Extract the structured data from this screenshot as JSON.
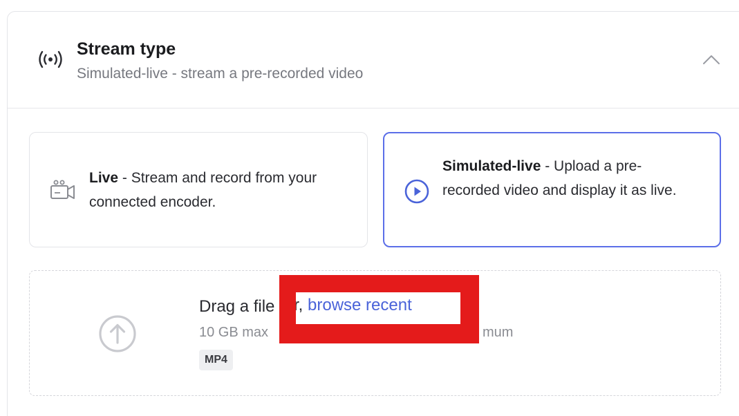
{
  "stream_type": {
    "icon": "broadcast-icon",
    "title": "Stream type",
    "subtitle": "Simulated-live - stream a pre-recorded video",
    "collapse_icon": "chevron-up-icon"
  },
  "options": {
    "live": {
      "icon": "camera-icon",
      "label": "Live",
      "description": " - Stream and record from your connected encoder."
    },
    "simulated": {
      "icon": "play-circle-icon",
      "label": "Simulated-live",
      "description": " - Upload a pre-recorded video and display it as live.",
      "selected": true
    }
  },
  "upload": {
    "icon": "upload-arrow-icon",
    "drag_text": "Drag a file or, ",
    "browse_text": "browse recent",
    "limits_text": "10 GB max",
    "limits_tail": "mum",
    "format_badge": "MP4"
  },
  "colors": {
    "accent": "#5b6ee8",
    "link": "#4a63d9",
    "redaction": "#e41b1b"
  }
}
